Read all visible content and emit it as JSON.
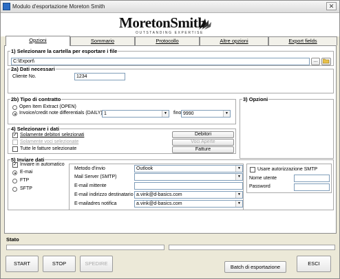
{
  "window": {
    "title": "Modulo d'esportazione Moreton Smith",
    "close_glyph": "✕"
  },
  "logo": {
    "name": "MoretonSmith",
    "tagline": "OUTSTANDING EXPERTISE"
  },
  "tabs": [
    {
      "label": "Opzioni",
      "active": true
    },
    {
      "label": "Sommario"
    },
    {
      "label": "Protocollo"
    },
    {
      "label": "Altre opzioni"
    },
    {
      "label": "Export fields"
    }
  ],
  "section1": {
    "title": "1) Selezionare la cartella per esportare i file",
    "path_value": "C:\\Export\\",
    "browse_label": "...",
    "folder_icon": "folder-open-icon"
  },
  "section2a": {
    "title": "2a) Dati necessari",
    "client_label": "Cliente No.",
    "client_value": "1234"
  },
  "section2b": {
    "title": "2b) Tipo di contratto",
    "option_open": "Open Item Extract (OPEN)",
    "option_daily": "Invoice/credit note differentials (DAILY)",
    "from_value": "1",
    "to_label": "fino a",
    "to_value": "9990"
  },
  "section3": {
    "title": "3) Opzioni"
  },
  "section4": {
    "title": "4) Selezionare i dati",
    "check_debitori": "Solamente debitori selezionati",
    "check_voci": "Solamente voci selezionate",
    "check_fatture": "Tutte le fatture selezionate",
    "btn_debitori": "Debitori",
    "btn_voci": "Voci Aperte",
    "btn_fatture": "Fatture"
  },
  "section5": {
    "title": "5) Inviare dati",
    "check_auto": "Inviare in automatico",
    "radio_email": "E-mai",
    "radio_ftp": "FTP",
    "radio_sftp": "SFTP",
    "method_label": "Metodo d'invio",
    "method_value": "Outlook",
    "smtp_label": "Mail Server (SMTP)",
    "smtp_value": "",
    "sender_label": "E-mail mittente",
    "sender_value": "",
    "recipient_label": "E-mail indirizzo destinatario",
    "recipient_value": "a.vink@d-basics.com",
    "notify_label": "E-mailadres notifica",
    "notify_value": "a.vink@d-basics.com",
    "smtp_auth_label": "Usare autorizzazione SMTP",
    "username_label": "Nome utente",
    "password_label": "Password"
  },
  "status": {
    "label": "Stato"
  },
  "buttons": {
    "start": "START",
    "stop": "STOP",
    "send": "SPEDIRE",
    "batch": "Batch di esportazione",
    "exit": "ESCI"
  }
}
